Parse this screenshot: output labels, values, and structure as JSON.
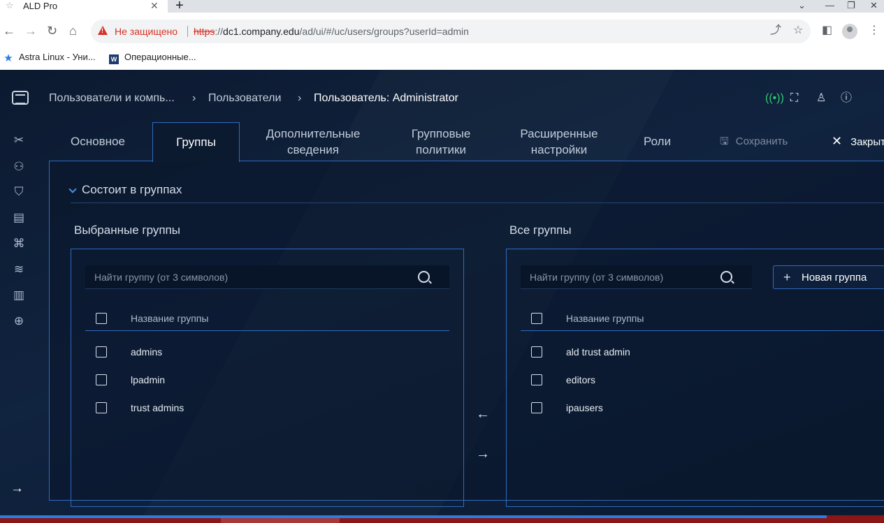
{
  "browser": {
    "tab_title": "ALD Pro",
    "tab_close": "✕",
    "new_tab": "+",
    "window_controls": [
      "⌄",
      "—",
      "❐",
      "✕"
    ],
    "nav": {
      "back": "←",
      "forward": "→",
      "reload": "↻",
      "home": "⌂"
    },
    "security_label": "Не защищено",
    "url_scheme": "https",
    "url_rest": "://",
    "url_host": "dc1.company.edu",
    "url_path": "/ad/ui/#/uc/users/groups?userId=admin",
    "bookmarks": [
      {
        "label": "Astra Linux - Уни...",
        "icon": "star-icon"
      },
      {
        "label": "Операционные...",
        "icon": "w-icon"
      }
    ]
  },
  "app": {
    "breadcrumb": {
      "item1": "Пользователи и компь...",
      "item2": "Пользователи",
      "current": "Пользователь: Administrator",
      "separator": "›"
    },
    "tabs": {
      "basic": "Основное",
      "groups": "Группы",
      "extra_line1": "Дополнительные",
      "extra_line2": "сведения",
      "policies_line1": "Групповые",
      "policies_line2": "политики",
      "advanced_line1": "Расширенные",
      "advanced_line2": "настройки",
      "roles": "Роли",
      "save": "Сохранить",
      "close": "Закрыть"
    },
    "section_title": "Состоит в группах",
    "selected": {
      "title": "Выбранные группы",
      "search_placeholder": "Найти группу (от 3 символов)",
      "header": "Название группы",
      "rows": [
        "admins",
        "lpadmin",
        "trust admins"
      ]
    },
    "all": {
      "title": "Все группы",
      "search_placeholder": "Найти группу (от 3 символов)",
      "header": "Название группы",
      "new_group": "Новая группа",
      "rows": [
        "ald trust admin",
        "editors",
        "ipausers"
      ]
    },
    "colors": {
      "accent": "#2f6bbf",
      "background": "#0d1c33",
      "online": "#2ecc71"
    },
    "taskbar_progress": 0.935
  }
}
